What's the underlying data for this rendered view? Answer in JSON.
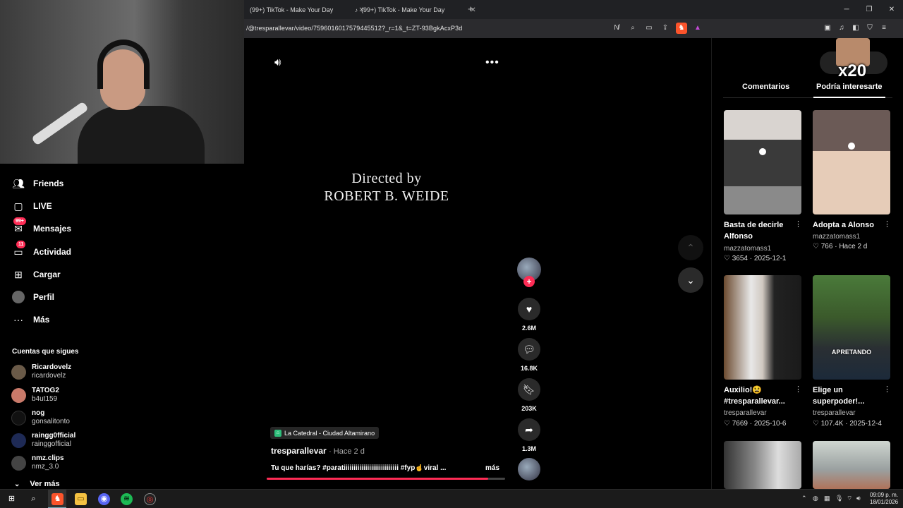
{
  "browser": {
    "tabs": [
      {
        "label": "(99+) TikTok - Make Your Day"
      },
      {
        "label": "(99+) TikTok - Make Your Day"
      }
    ],
    "url": "/@tresparallevar/video/7596016017579445512?_r=1&_t=ZT-93BgkAcxP3d"
  },
  "sidebar": {
    "items": [
      {
        "label": "Friends",
        "icon": "friends-icon"
      },
      {
        "label": "LIVE",
        "icon": "live-icon"
      },
      {
        "label": "Mensajes",
        "icon": "messages-icon",
        "badge": "99+"
      },
      {
        "label": "Actividad",
        "icon": "activity-icon",
        "badge": "11"
      },
      {
        "label": "Cargar",
        "icon": "upload-icon"
      },
      {
        "label": "Perfil",
        "icon": "profile-icon"
      },
      {
        "label": "Más",
        "icon": "more-icon"
      }
    ],
    "following_header": "Cuentas que sigues",
    "following": [
      {
        "name": "Ricardovelz",
        "handle": "ricardovelz"
      },
      {
        "name": "TATOG2",
        "handle": "b4ut159"
      },
      {
        "name": "nog",
        "handle": "gonsalitonto"
      },
      {
        "name": "raingg0fficial",
        "handle": "rainggofficial"
      },
      {
        "name": "nmz.clips",
        "handle": "nmz_3.0"
      }
    ],
    "see_more": "Ver más"
  },
  "video": {
    "overlay_line1": "Directed by",
    "overlay_line2": "ROBERT B. WEIDE",
    "location": "La Catedral - Ciudad Altamirano",
    "author": "tresparallevar",
    "ago": "· Hace 2 d",
    "caption": "Tu que harías? #paratiiiiiiiiiiiiiiiiiiiiiiiiiiii #fyp☝viral ...",
    "more": "más",
    "progress": 0.93,
    "likes": "2.6M",
    "comments": "16.8K",
    "saves": "203K",
    "shares": "1.3M"
  },
  "right_panel": {
    "overlay_text": "x20",
    "tabs": [
      "Comentarios",
      "Podría interesarte"
    ],
    "cards": [
      {
        "title": "Basta de decirle Alfonso",
        "author": "mazzatomass1",
        "likes": "3654",
        "date": "2025-12-1"
      },
      {
        "title": "Adopta a Alonso",
        "author": "mazzatomass1",
        "likes": "766",
        "date": "Hace 2 d"
      },
      {
        "title": "Auxilio!😫 #tresparallevar...",
        "author": "tresparallevar",
        "likes": "7669",
        "date": "2025-10-6"
      },
      {
        "title": "Elige un superpoder!...",
        "author": "tresparallevar",
        "likes": "107.4K",
        "date": "2025-12-4",
        "thumb_text": "APRETANDO"
      }
    ]
  },
  "taskbar": {
    "time": "09:09 p. m.",
    "date": "18/01/2026"
  }
}
